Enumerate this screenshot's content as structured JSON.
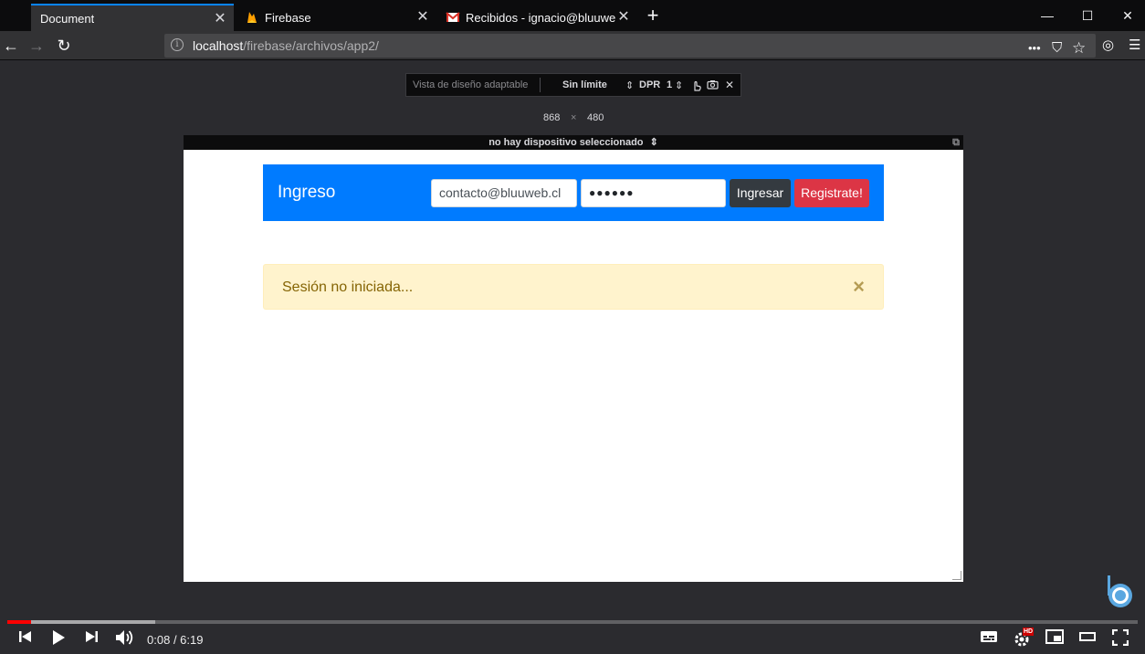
{
  "browser": {
    "tabs": [
      {
        "label": "Document",
        "close": "✕"
      },
      {
        "label": "Firebase",
        "close": "✕"
      },
      {
        "label": "Recibidos - ignacio@bluuweb.cl",
        "close": "✕"
      }
    ],
    "new_tab": "+",
    "window_controls": {
      "minimize": "—",
      "maximize": "☐",
      "close": "✕"
    },
    "nav": {
      "back": "←",
      "forward": "→",
      "reload": "↻"
    },
    "url": {
      "host": "localhost",
      "path": "/firebase/archivos/app2/"
    },
    "url_icons": {
      "more": "•••",
      "pocket": "⛉",
      "bookmark": "☆",
      "extension": "◎",
      "menu": "☰"
    }
  },
  "rdm": {
    "placeholder": "Vista de diseño adaptable",
    "throttle": "Sin límite",
    "dpr_label": "DPR",
    "dpr_value": "1",
    "width": "868",
    "times": "×",
    "height": "480",
    "device": "no hay dispositivo seleccionado",
    "close": "✕"
  },
  "page": {
    "brand": "Ingreso",
    "email_value": "contacto@bluuweb.cl",
    "password_value": "●●●●●●",
    "login_button": "Ingresar",
    "register_button": "Registrate!",
    "alert_text": "Sesión no iniciada...",
    "alert_close": "×"
  },
  "player": {
    "current_time": "0:08",
    "duration": "6:19",
    "played_fraction": 0.021,
    "buffered_fraction": 0.131,
    "hd_badge": "HD"
  },
  "colors": {
    "primary": "#007bff",
    "dark": "#343a40",
    "danger": "#dc3545",
    "warning_bg": "#fff3cd",
    "progress": "#ff0000"
  }
}
